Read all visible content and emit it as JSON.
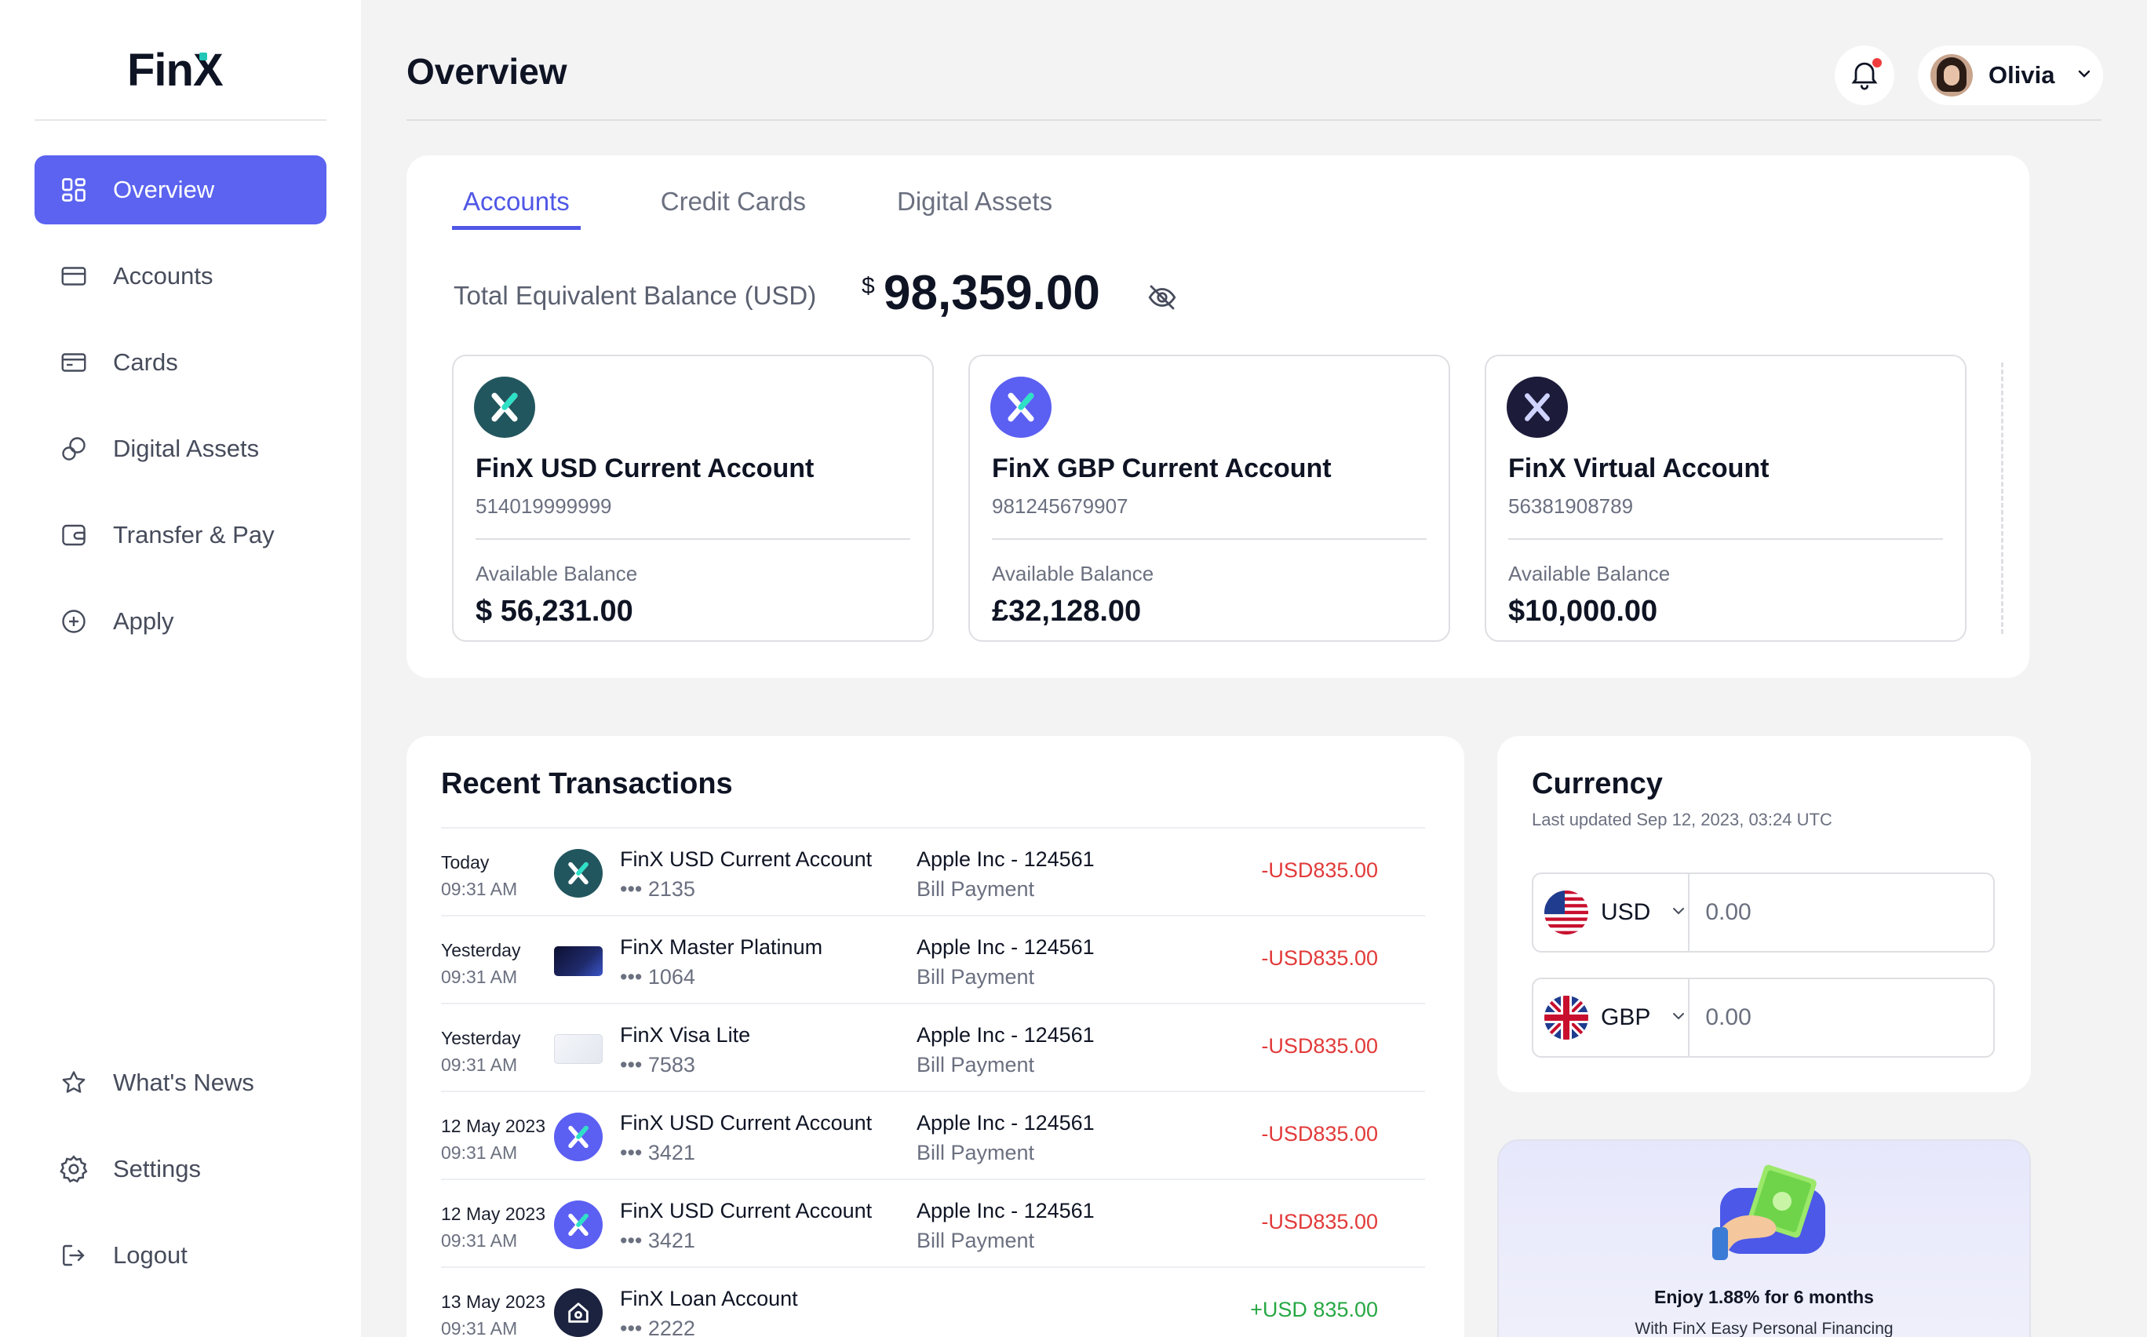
{
  "brand": {
    "logo_text": "Fin",
    "logo_x": "X"
  },
  "sidebar": {
    "items": [
      {
        "label": "Overview",
        "icon": "grid-icon"
      },
      {
        "label": "Accounts",
        "icon": "wallet-icon"
      },
      {
        "label": "Cards",
        "icon": "card-icon"
      },
      {
        "label": "Digital Assets",
        "icon": "coins-icon"
      },
      {
        "label": "Transfer & Pay",
        "icon": "transfer-icon"
      },
      {
        "label": "Apply",
        "icon": "plus-circle-icon"
      }
    ],
    "bottom_items": [
      {
        "label": "What's News",
        "icon": "star-icon"
      },
      {
        "label": "Settings",
        "icon": "gear-icon"
      },
      {
        "label": "Logout",
        "icon": "logout-icon"
      }
    ]
  },
  "header": {
    "title": "Overview",
    "user_name": "Olivia"
  },
  "accounts_panel": {
    "tabs": [
      "Accounts",
      "Credit Cards",
      "Digital Assets"
    ],
    "total_label": "Total Equivalent Balance (USD)",
    "total_currency": "$",
    "total_value": "98,359.00",
    "accounts": [
      {
        "name": "FinX USD Current Account",
        "number": "514019999999",
        "balance_label": "Available Balance",
        "balance": "$ 56,231.00",
        "color": "#22565e"
      },
      {
        "name": "FinX GBP Current Account",
        "number": "981245679907",
        "balance_label": "Available Balance",
        "balance": "£32,128.00",
        "color": "#5b5ff2"
      },
      {
        "name": "FinX Virtual Account",
        "number": "56381908789",
        "balance_label": "Available Balance",
        "balance": "$10,000.00",
        "color": "#1c1b3a"
      }
    ]
  },
  "transactions": {
    "title": "Recent Transactions",
    "rows": [
      {
        "date": "Today",
        "time": "09:31 AM",
        "account": "FinX USD Current Account",
        "masked": "••• 2135",
        "merchant": "Apple Inc - 124561",
        "type": "Bill Payment",
        "amount": "-USD835.00",
        "kind": "teal-x"
      },
      {
        "date": "Yesterday",
        "time": "09:31 AM",
        "account": "FinX Master Platinum",
        "masked": "••• 1064",
        "merchant": "Apple Inc - 124561",
        "type": "Bill Payment",
        "amount": "-USD835.00",
        "kind": "dark-card"
      },
      {
        "date": "Yesterday",
        "time": "09:31 AM",
        "account": "FinX Visa Lite",
        "masked": "••• 7583",
        "merchant": "Apple Inc - 124561",
        "type": "Bill Payment",
        "amount": "-USD835.00",
        "kind": "light-card"
      },
      {
        "date": "12 May 2023",
        "time": "09:31 AM",
        "account": "FinX USD Current Account",
        "masked": "••• 3421",
        "merchant": "Apple Inc - 124561",
        "type": "Bill Payment",
        "amount": "-USD835.00",
        "kind": "purple-x"
      },
      {
        "date": "12 May 2023",
        "time": "09:31 AM",
        "account": "FinX USD Current Account",
        "masked": "••• 3421",
        "merchant": "Apple Inc - 124561",
        "type": "Bill Payment",
        "amount": "-USD835.00",
        "kind": "purple-x"
      },
      {
        "date": "13 May 2023",
        "time": "09:31 AM",
        "account": "FinX Loan Account",
        "masked": "••• 2222",
        "merchant": "",
        "type": "",
        "amount": "+USD 835.00",
        "kind": "house"
      }
    ]
  },
  "currency": {
    "title": "Currency",
    "updated": "Last updated Sep 12, 2023, 03:24 UTC",
    "rows": [
      {
        "code": "USD",
        "value": "0.00",
        "flag": "us-flag-icon"
      },
      {
        "code": "GBP",
        "value": "0.00",
        "flag": "uk-flag-icon"
      }
    ]
  },
  "promo": {
    "title": "Enjoy 1.88% for 6 months",
    "subtitle": "With FinX Easy Personal Financing"
  },
  "colors": {
    "accent": "#5b63f0",
    "negative": "#e23a3a",
    "positive": "#27a844"
  }
}
